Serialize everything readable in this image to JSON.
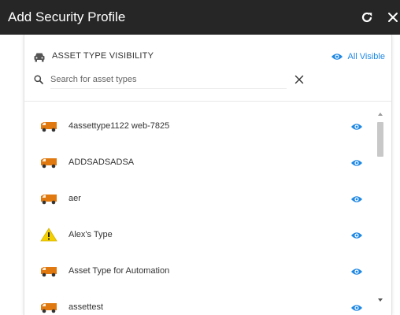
{
  "window": {
    "title": "Add Security Profile",
    "refresh_icon": "refresh-icon",
    "close_icon": "close-icon"
  },
  "visibility_header": {
    "icon": "car-icon",
    "label": "ASSET TYPE VISIBILITY",
    "toggle_icon": "eye-icon",
    "toggle_label": "All Visible"
  },
  "search": {
    "icon": "search-icon",
    "placeholder": "Search for asset types",
    "value": "",
    "clear_icon": "close-icon"
  },
  "asset_types": [
    {
      "label": "4assettype1122 web-7825",
      "icon": "truck-icon"
    },
    {
      "label": "ADDSADSADSA",
      "icon": "truck-icon"
    },
    {
      "label": "aer",
      "icon": "truck-icon"
    },
    {
      "label": "Alex's Type",
      "icon": "warning-icon"
    },
    {
      "label": "Asset Type for Automation",
      "icon": "truck-icon"
    },
    {
      "label": "assettest",
      "icon": "truck-icon"
    }
  ],
  "colors": {
    "titlebar": "#262626",
    "accent": "#1e88e5",
    "truck": "#e07a10",
    "warning": "#f5d000"
  }
}
